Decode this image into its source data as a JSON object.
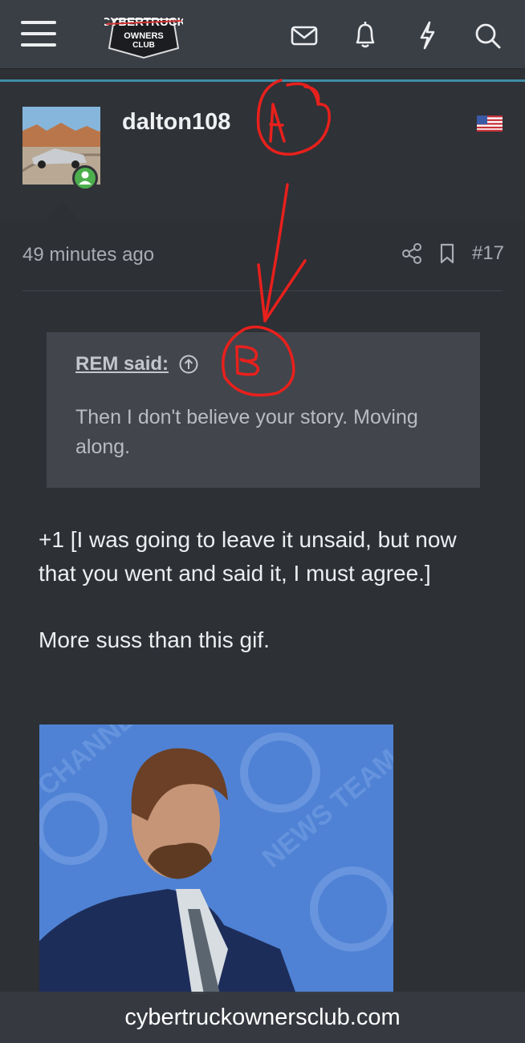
{
  "header": {
    "logo_alt": "Cybertruck Owners Club",
    "icons": [
      "menu-icon",
      "envelope-icon",
      "bell-icon",
      "lightning-icon",
      "search-icon"
    ]
  },
  "post": {
    "username": "dalton108",
    "flag": "us-flag-icon",
    "time": "49 minutes ago",
    "post_number": "#17",
    "quote": {
      "author": "REM said:",
      "text": "Then I don't believe your story. Moving along."
    },
    "paragraphs": [
      "+1 [I was going to leave it unsaid, but now that you went and said it, I must agree.]",
      "More suss than this gif."
    ]
  },
  "annotations": [
    "A",
    "B"
  ],
  "footer": {
    "site": "cybertruckownersclub.com"
  },
  "colors": {
    "background": "#2d3035",
    "topbar": "#3a3e45",
    "accent": "#3e8ea7",
    "annotation": "#e8201c",
    "online": "#4cae4c"
  }
}
